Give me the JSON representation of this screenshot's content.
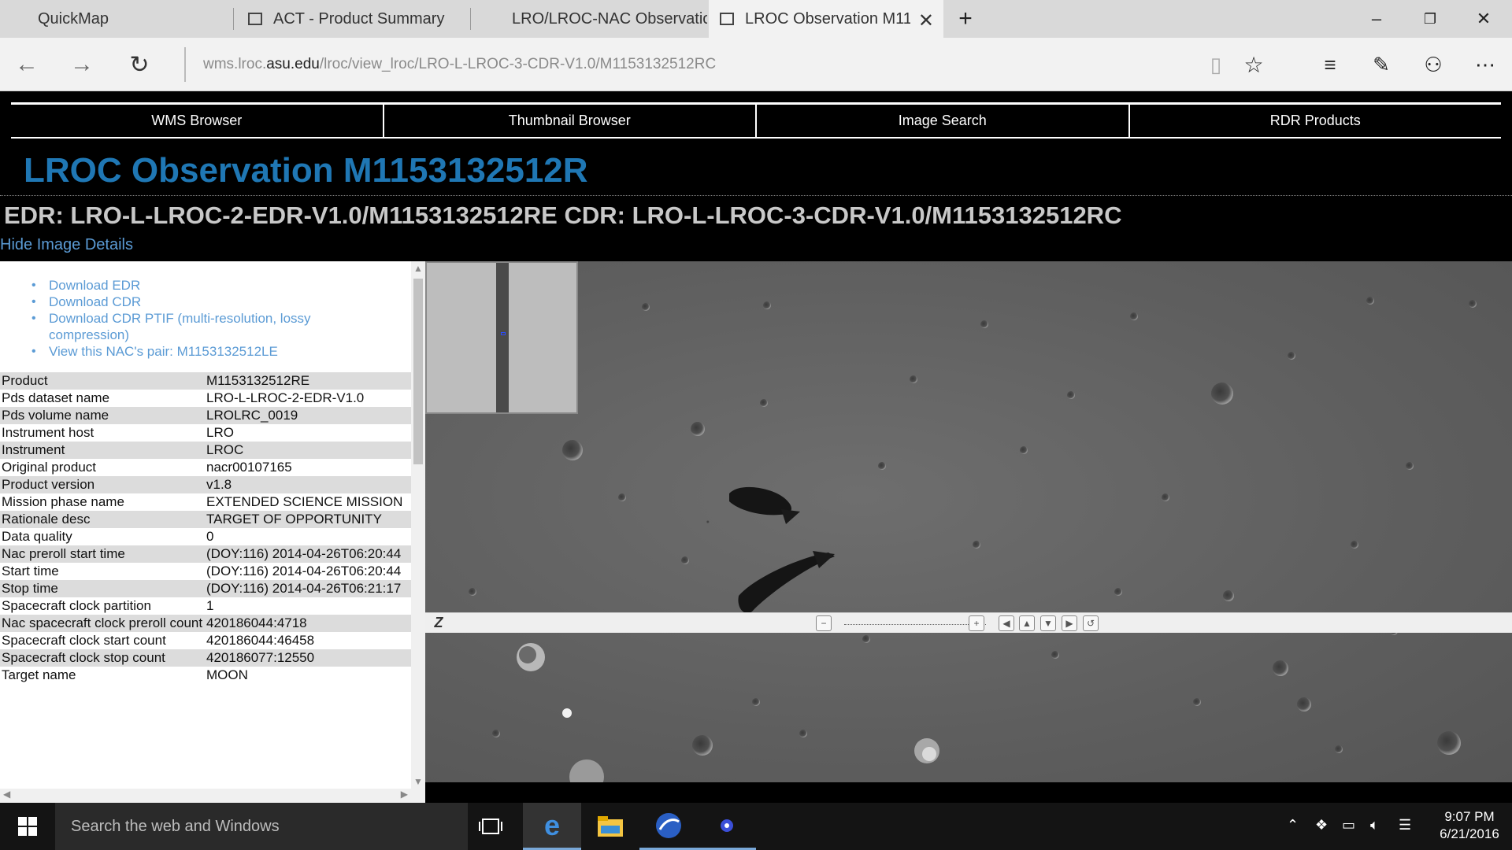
{
  "browser": {
    "tabs": [
      {
        "label": "QuickMap",
        "active": false
      },
      {
        "label": "ACT - Product Summary",
        "active": false
      },
      {
        "label": "LRO/LROC-NAC Observatio",
        "active": false
      },
      {
        "label": "LROC Observation M11!",
        "active": true
      }
    ],
    "new_tab_symbol": "+",
    "address_prefix": "wms.lroc.",
    "address_domain": "asu.edu",
    "address_path": "/lroc/view_lroc/LRO-L-LROC-3-CDR-V1.0/M1153132512RC"
  },
  "page": {
    "menu": [
      "WMS Browser",
      "Thumbnail Browser",
      "Image Search",
      "RDR Products"
    ],
    "title": "LROC Observation M1153132512R",
    "subtitle": "EDR: LRO-L-LROC-2-EDR-V1.0/M1153132512RE CDR: LRO-L-LROC-3-CDR-V1.0/M1153132512RC",
    "hide_details": "Hide Image Details",
    "downloads": [
      "Download EDR",
      "Download CDR",
      "Download CDR PTIF (multi-resolution, lossy compression)",
      "View this NAC's pair: M1153132512LE"
    ],
    "metadata": [
      {
        "key": "Product",
        "value": "M1153132512RE"
      },
      {
        "key": "Pds dataset name",
        "value": "LRO-L-LROC-2-EDR-V1.0"
      },
      {
        "key": "Pds volume name",
        "value": "LROLRC_0019"
      },
      {
        "key": "Instrument host",
        "value": "LRO"
      },
      {
        "key": "Instrument",
        "value": "LROC"
      },
      {
        "key": "Original product",
        "value": "nacr00107165"
      },
      {
        "key": "Product version",
        "value": "v1.8"
      },
      {
        "key": "Mission phase name",
        "value": "EXTENDED SCIENCE MISSION"
      },
      {
        "key": "Rationale desc",
        "value": "TARGET OF OPPORTUNITY"
      },
      {
        "key": "Data quality",
        "value": "0"
      },
      {
        "key": "Nac preroll start time",
        "value": "(DOY:116) 2014-04-26T06:20:44"
      },
      {
        "key": "Start time",
        "value": "(DOY:116) 2014-04-26T06:20:44"
      },
      {
        "key": "Stop time",
        "value": "(DOY:116) 2014-04-26T06:21:17"
      },
      {
        "key": "Spacecraft clock partition",
        "value": "1"
      },
      {
        "key": "Nac spacecraft clock preroll count",
        "value": "420186044:4718"
      },
      {
        "key": "Spacecraft clock start count",
        "value": "420186044:46458"
      },
      {
        "key": "Spacecraft clock stop count",
        "value": "420186077:12550"
      },
      {
        "key": "Target name",
        "value": "MOON"
      }
    ]
  },
  "taskbar": {
    "search_placeholder": "Search the web and Windows",
    "time": "9:07 PM",
    "date": "6/21/2016"
  },
  "colors": {
    "title_blue": "#1f77b4",
    "link_blue": "#5b9bd5"
  }
}
